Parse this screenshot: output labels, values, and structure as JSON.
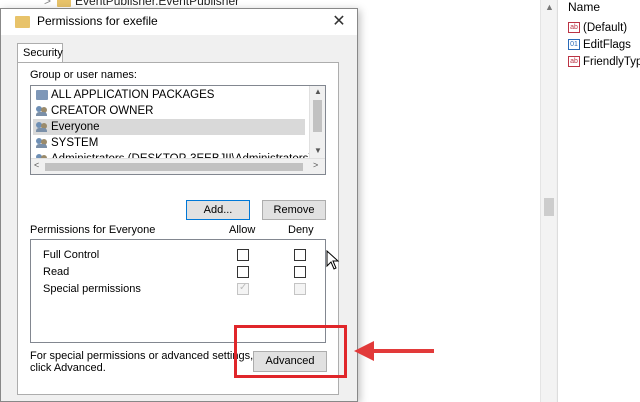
{
  "background": {
    "tree_item": "EventPublisher.EventPublisher",
    "values_header": "Name",
    "values": [
      {
        "icon": "string-value-icon",
        "label": "(Default)"
      },
      {
        "icon": "binary-value-icon",
        "label": "EditFlags"
      },
      {
        "icon": "string-value-icon",
        "label": "FriendlyTyp"
      }
    ]
  },
  "dialog": {
    "title": "Permissions for exefile",
    "tab_security": "Security",
    "group_label": "Group or user names:",
    "users": [
      {
        "icon": "package-icon",
        "label": "ALL APPLICATION PACKAGES"
      },
      {
        "icon": "users-icon",
        "label": "CREATOR OWNER"
      },
      {
        "icon": "users-icon",
        "label": "Everyone",
        "selected": true
      },
      {
        "icon": "users-icon",
        "label": "SYSTEM"
      },
      {
        "icon": "users-icon",
        "label": "Administrators (DESKTOP-3EEBJII\\Administrators)"
      }
    ],
    "add_button": "Add...",
    "remove_button": "Remove",
    "permissions_for": "Permissions for Everyone",
    "allow_header": "Allow",
    "deny_header": "Deny",
    "permissions": [
      {
        "name": "Full Control",
        "allow": false,
        "deny": false
      },
      {
        "name": "Read",
        "allow": false,
        "deny": false
      },
      {
        "name": "Special permissions",
        "allow": true,
        "deny": false,
        "disabled": true
      }
    ],
    "advanced_note_line1": "For special permissions or advanced settings,",
    "advanced_note_line2": "click Advanced.",
    "advanced_button": "Advanced"
  },
  "colors": {
    "highlight": "#e0262a",
    "selection": "#d9d9d9",
    "focus_border": "#0078d7"
  }
}
